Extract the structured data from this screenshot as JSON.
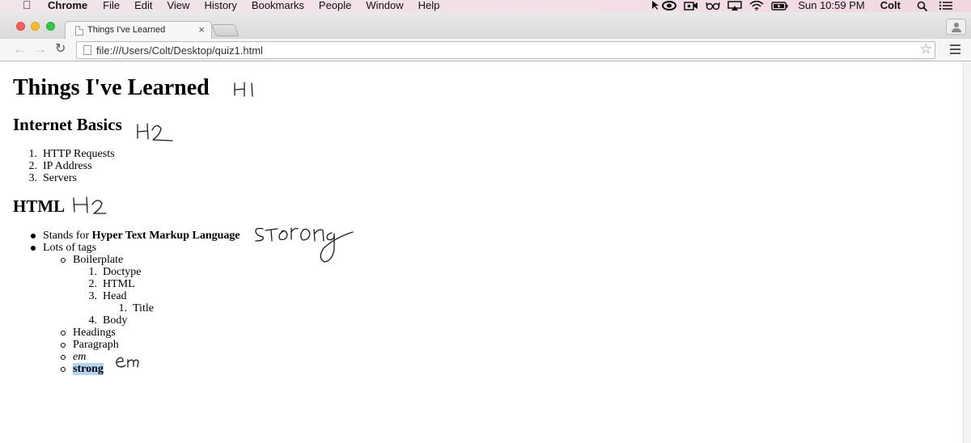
{
  "menubar": {
    "app_name": "Chrome",
    "menus": [
      "File",
      "Edit",
      "View",
      "History",
      "Bookmarks",
      "People",
      "Window",
      "Help"
    ],
    "status_icons": [
      "creative-cloud-icon",
      "facetime-icon",
      "glasses-icon",
      "airplay-icon",
      "wifi-icon",
      "battery-icon"
    ],
    "clock": "Sun 10:59 PM",
    "user": "Colt"
  },
  "browser": {
    "tab_title": "Things I've Learned",
    "tab_close": "×",
    "url": "file:///Users/Colt/Desktop/quiz1.html"
  },
  "page": {
    "h1": "Things I've Learned",
    "section1": {
      "heading": "Internet Basics",
      "items": [
        "HTTP Requests",
        "IP Address",
        "Servers"
      ]
    },
    "section2": {
      "heading": "HTML",
      "stands_prefix": "Stands for",
      "stands_strong": "Hyper Text Markup Language",
      "lots_of_tags": "Lots of tags",
      "boilerplate": "Boilerplate",
      "boilerplate_items": [
        "Doctype",
        "HTML",
        "Head",
        "Body"
      ],
      "head_items": [
        "Title"
      ],
      "other_tags": [
        "Headings",
        "Paragraph"
      ],
      "em_item": "em",
      "strong_item": "strong"
    }
  },
  "annotations": {
    "h1_note": "H1",
    "h2_note_1": "H2",
    "h2_note_2": "H2",
    "strong_note": "strong",
    "em_note": "em"
  }
}
